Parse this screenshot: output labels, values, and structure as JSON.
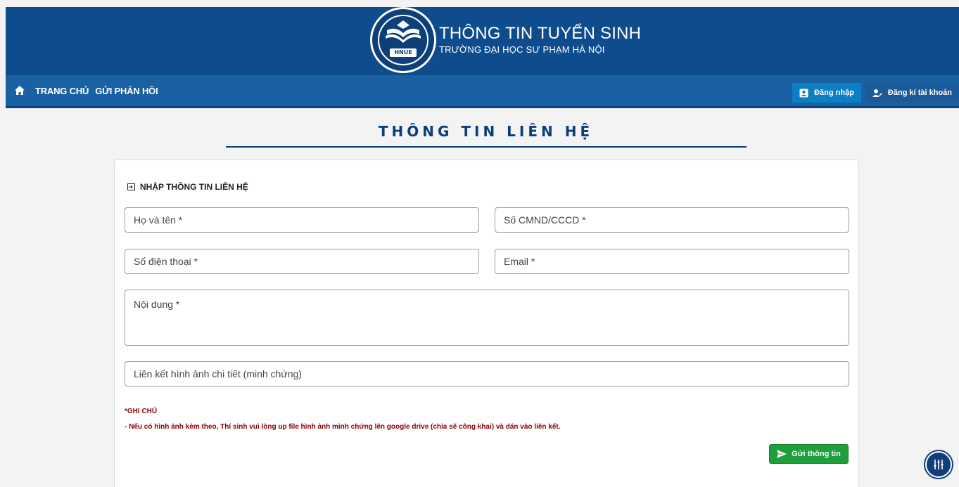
{
  "header": {
    "logo_badge": "HNUE",
    "title": "THÔNG TIN TUYỂN SINH",
    "subtitle": "TRƯỜNG ĐẠI HỌC SƯ PHẠM HÀ NỘI",
    "brand_color": "#0f4c8e"
  },
  "nav": {
    "home_icon": "home-icon",
    "links": [
      "TRANG CHỦ",
      "GỬI PHẢN HỒI"
    ],
    "login_label": "Đăng nhập",
    "register_label": "Đăng kí tài khoản"
  },
  "page": {
    "title": "THÔNG TIN LIÊN HỆ"
  },
  "form": {
    "section_title": "NHẬP THÔNG TIN LIÊN HỆ",
    "name_placeholder": "Họ và tên *",
    "id_placeholder": "Số CMND/CCCD *",
    "phone_placeholder": "Số điện thoại *",
    "email_placeholder": "Email *",
    "content_placeholder": "Nội dung *",
    "link_placeholder": "Liên kết hình ảnh chi tiết (minh chứng)",
    "note_title": "*GHI CHÚ",
    "note_text": "- Nếu có hình ảnh kèm theo, Thí sinh vui lòng up file hình ảnh minh chứng lên google drive (chia sẽ công khai) và dán vào liên kết.",
    "submit_label": "Gửi thông tin",
    "note_color": "#8b0000",
    "submit_color": "#1e9e3c"
  },
  "floating": {
    "icon": "sliders-icon"
  }
}
